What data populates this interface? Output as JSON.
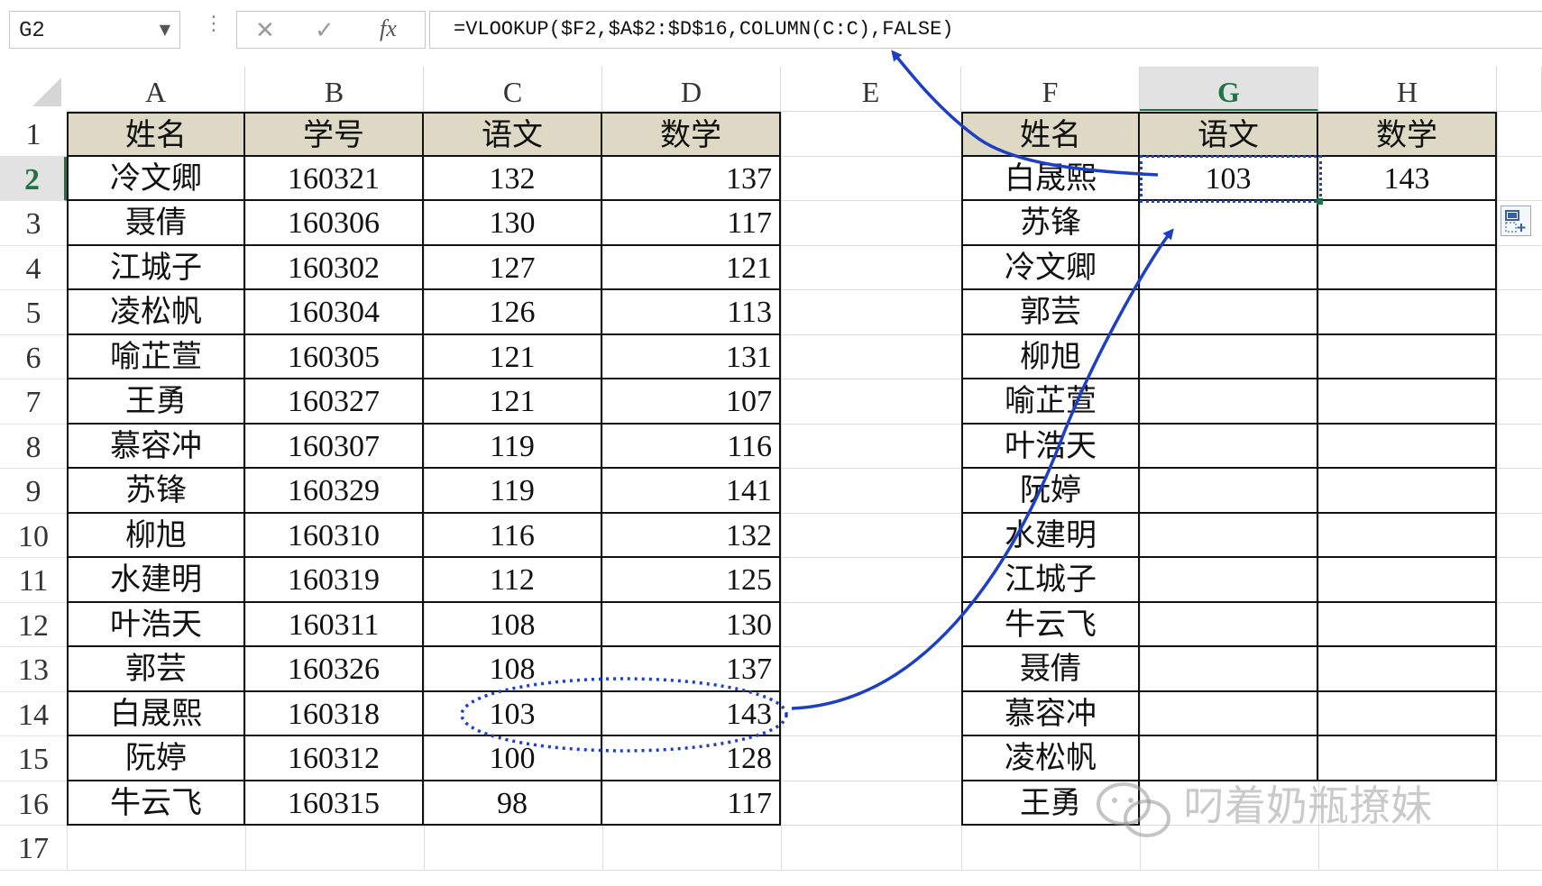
{
  "formula_bar": {
    "name_box": "G2",
    "cancel_icon": "✕",
    "enter_icon": "✓",
    "fx_label": "fx",
    "formula": "=VLOOKUP($F2,$A$2:$D$16,COLUMN(C:C),FALSE)"
  },
  "columns": [
    "A",
    "B",
    "C",
    "D",
    "E",
    "F",
    "G",
    "H"
  ],
  "rows": [
    "1",
    "2",
    "3",
    "4",
    "5",
    "6",
    "7",
    "8",
    "9",
    "10",
    "11",
    "12",
    "13",
    "14",
    "15",
    "16",
    "17"
  ],
  "selected": {
    "column": "G",
    "row": "2"
  },
  "source_table": {
    "headers": [
      "姓名",
      "学号",
      "语文",
      "数学"
    ],
    "records": [
      [
        "冷文卿",
        "160321",
        "132",
        "137"
      ],
      [
        "聂倩",
        "160306",
        "130",
        "117"
      ],
      [
        "江城子",
        "160302",
        "127",
        "121"
      ],
      [
        "凌松帆",
        "160304",
        "126",
        "113"
      ],
      [
        "喻芷萱",
        "160305",
        "121",
        "131"
      ],
      [
        "王勇",
        "160327",
        "121",
        "107"
      ],
      [
        "慕容冲",
        "160307",
        "119",
        "116"
      ],
      [
        "苏锋",
        "160329",
        "119",
        "141"
      ],
      [
        "柳旭",
        "160310",
        "116",
        "132"
      ],
      [
        "水建明",
        "160319",
        "112",
        "125"
      ],
      [
        "叶浩天",
        "160311",
        "108",
        "130"
      ],
      [
        "郭芸",
        "160326",
        "108",
        "137"
      ],
      [
        "白晟熙",
        "160318",
        "103",
        "143"
      ],
      [
        "阮婷",
        "160312",
        "100",
        "128"
      ],
      [
        "牛云飞",
        "160315",
        "98",
        "117"
      ]
    ]
  },
  "lookup_table": {
    "headers": [
      "姓名",
      "语文",
      "数学"
    ],
    "names": [
      "白晟熙",
      "苏锋",
      "冷文卿",
      "郭芸",
      "柳旭",
      "喻芷萱",
      "叶浩天",
      "阮婷",
      "水建明",
      "江城子",
      "牛云飞",
      "聂倩",
      "慕容冲",
      "凌松帆",
      "王勇"
    ],
    "g2": "103",
    "h2": "143"
  },
  "watermark": "叼着奶瓶撩妹",
  "colors": {
    "annotation": "#1d3fc4",
    "header_fill": "#ddd9c4",
    "selection_green": "#217346"
  }
}
